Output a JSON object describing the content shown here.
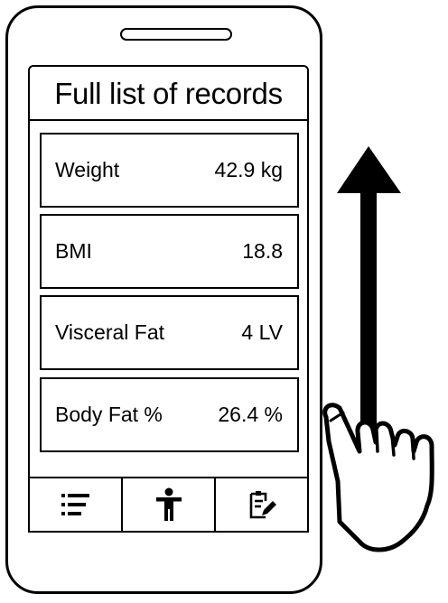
{
  "screen": {
    "title": "Full list of records"
  },
  "records": [
    {
      "label": "Weight",
      "value": "42.9 kg"
    },
    {
      "label": "BMI",
      "value": "18.8"
    },
    {
      "label": "Visceral Fat",
      "value": "4 LV"
    },
    {
      "label": "Body Fat %",
      "value": "26.4 %"
    }
  ],
  "nav": {
    "items": [
      {
        "icon": "list-icon"
      },
      {
        "icon": "person-icon"
      },
      {
        "icon": "edit-note-icon"
      }
    ]
  },
  "gesture": {
    "icons": [
      "up-arrow-icon",
      "hand-pointer-icon"
    ]
  }
}
